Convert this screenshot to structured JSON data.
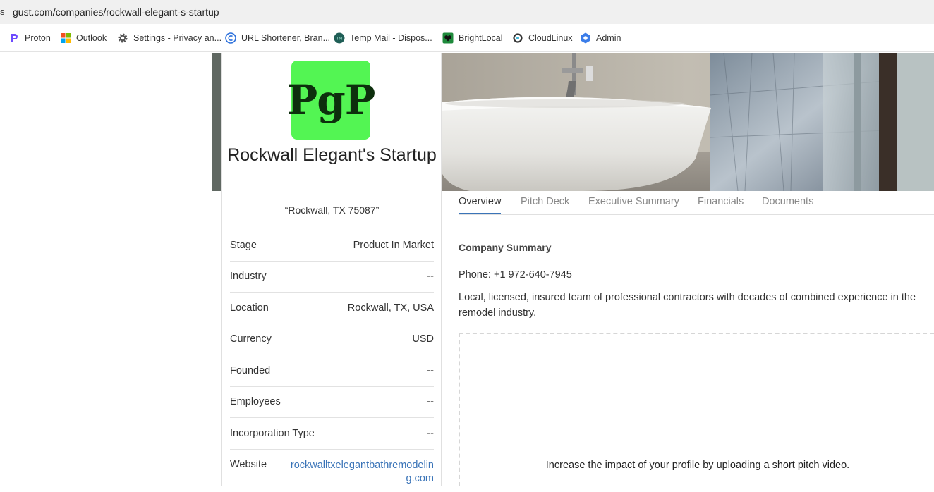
{
  "browser": {
    "address_edge": "s",
    "url": "gust.com/companies/rockwall-elegant-s-startup"
  },
  "bookmarks": [
    {
      "label": "Proton",
      "icon": "proton-icon"
    },
    {
      "label": "Outlook",
      "icon": "microsoft-icon"
    },
    {
      "label": "Settings - Privacy an...",
      "icon": "gear-icon"
    },
    {
      "label": "URL Shortener, Bran...",
      "icon": "c-circle-icon"
    },
    {
      "label": "Temp Mail - Dispos...",
      "icon": "tempmail-icon"
    },
    {
      "label": "BrightLocal",
      "icon": "brightlocal-icon"
    },
    {
      "label": "CloudLinux",
      "icon": "cloudlinux-icon"
    },
    {
      "label": "Admin",
      "icon": "admin-hex-icon"
    }
  ],
  "company": {
    "logo_text": "PgP",
    "logo_color": "#53f553",
    "name": "Rockwall Elegant's Startup",
    "tagline": "“Rockwall, TX 75087”"
  },
  "info": [
    {
      "label": "Stage",
      "value": "Product In Market"
    },
    {
      "label": "Industry",
      "value": "--"
    },
    {
      "label": "Location",
      "value": "Rockwall, TX, USA"
    },
    {
      "label": "Currency",
      "value": "USD"
    },
    {
      "label": "Founded",
      "value": "--"
    },
    {
      "label": "Employees",
      "value": "--"
    },
    {
      "label": "Incorporation Type",
      "value": "--"
    },
    {
      "label": "Website",
      "value": "rockwalltxelegantbathremodeling.com"
    }
  ],
  "tabs": [
    "Overview",
    "Pitch Deck",
    "Executive Summary",
    "Financials",
    "Documents"
  ],
  "active_tab": "Overview",
  "summary": {
    "title": "Company Summary",
    "phone": "Phone: +1 972-640-7945",
    "description": "Local, licensed, insured team of professional contractors with decades of combined experience in the remodel industry."
  },
  "video_prompt": "Increase the impact of your profile by uploading a short pitch video.",
  "colors": {
    "accent": "#3a74b8",
    "link": "#3a74b8"
  }
}
